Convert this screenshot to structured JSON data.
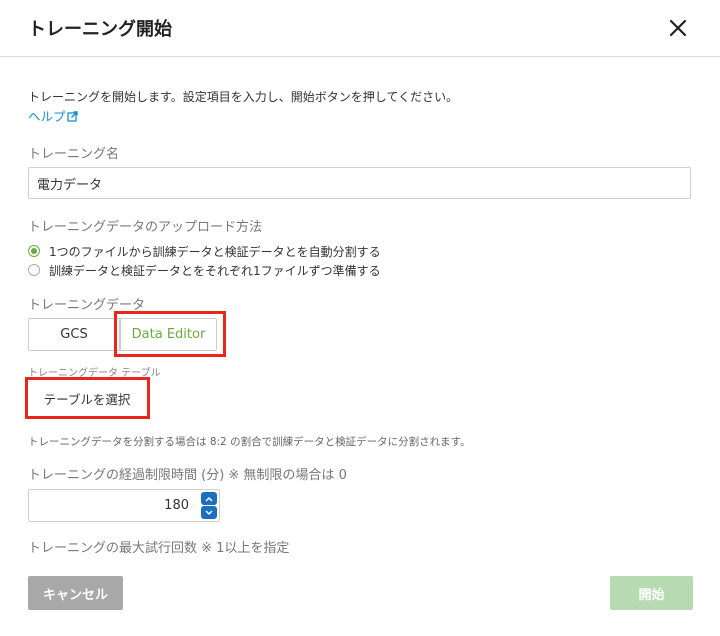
{
  "dialog": {
    "title": "トレーニング開始",
    "close_icon": "close-icon"
  },
  "intro": {
    "text": "トレーニングを開始します。設定項目を入力し、開始ボタンを押してください。",
    "help_label": "ヘルプ",
    "help_icon": "external-link-icon"
  },
  "training_name": {
    "label": "トレーニング名",
    "value": "電力データ"
  },
  "upload_method": {
    "label": "トレーニングデータのアップロード方法",
    "options": [
      {
        "label": "1つのファイルから訓練データと検証データとを自動分割する",
        "selected": true
      },
      {
        "label": "訓練データと検証データとをそれぞれ1ファイルずつ準備する",
        "selected": false
      }
    ]
  },
  "training_data": {
    "label": "トレーニングデータ",
    "sources": [
      {
        "label": "GCS",
        "selected": false
      },
      {
        "label": "Data Editor",
        "selected": true
      }
    ],
    "table_label": "トレーニングデータ テーブル",
    "select_table_label": "テーブルを選択",
    "note": "トレーニングデータを分割する場合は 8:2 の割合で訓練データと検証データに分割されます。"
  },
  "time_limit": {
    "label": "トレーニングの経過制限時間 (分) ※ 無制限の場合は 0",
    "value": "180"
  },
  "max_trials": {
    "label": "トレーニングの最大試行回数 ※ 1以上を指定"
  },
  "footer": {
    "cancel_label": "キャンセル",
    "start_label": "開始"
  },
  "colors": {
    "accent_green": "#6aab3e",
    "link_blue": "#1a8fd0",
    "highlight_red": "#e8271a",
    "spinner_blue": "#1d6fbd",
    "cancel_gray": "#a8a8a8",
    "start_disabled_green": "#b7dab2"
  }
}
